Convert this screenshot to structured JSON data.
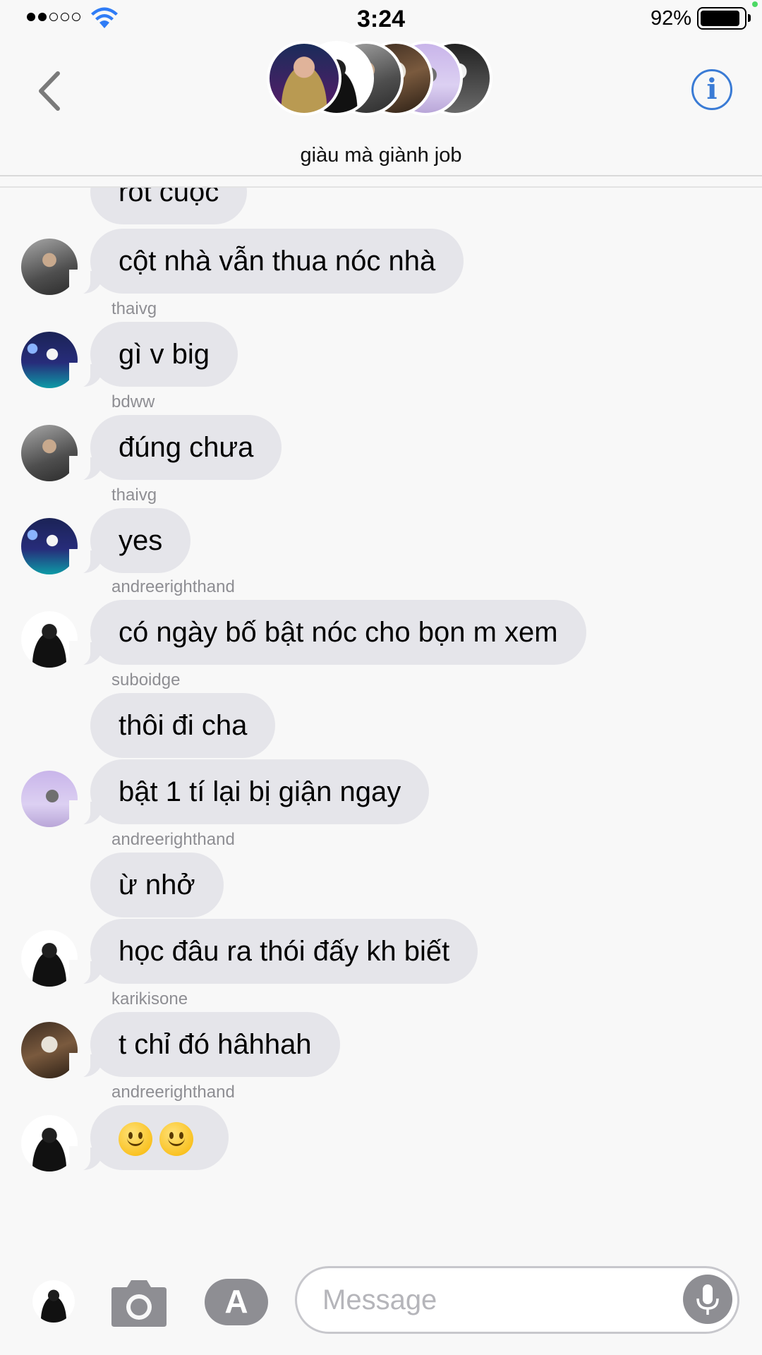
{
  "status_bar": {
    "time": "3:24",
    "battery_percent": "92%",
    "signal_bars": 2,
    "signal_total": 5,
    "battery_level": 0.92
  },
  "header": {
    "group_name": "giàu mà giành job",
    "icons": [
      "back-chevron-icon",
      "info-icon"
    ],
    "info_glyph": "i",
    "accent_color": "#3a7bd5"
  },
  "messages": [
    {
      "text": "rốt cuộc",
      "sender": "",
      "avatar": ""
    },
    {
      "text": "cột nhà vẫn thua nóc nhà",
      "sender": "",
      "avatar": "av-a"
    },
    {
      "text": "gì v big",
      "sender": "thaivg",
      "avatar": "av-b"
    },
    {
      "text": "đúng chưa",
      "sender": "bdww",
      "avatar": "av-a"
    },
    {
      "text": "yes",
      "sender": "thaivg",
      "avatar": "av-b"
    },
    {
      "text": "có ngày bố bật nóc cho bọn m xem",
      "sender": "andreerighthand",
      "avatar": "av-c"
    },
    {
      "text": "thôi đi cha",
      "sender": "suboidge",
      "avatar": ""
    },
    {
      "text": "bật 1 tí lại bị giận ngay",
      "sender": "",
      "avatar": "av-d"
    },
    {
      "text": "ừ nhở",
      "sender": "andreerighthand",
      "avatar": ""
    },
    {
      "text": "học đâu ra thói đấy kh biết",
      "sender": "",
      "avatar": "av-c"
    },
    {
      "text": "t chỉ đó hâhhah",
      "sender": "karikisone",
      "avatar": "av-e"
    },
    {
      "text": "",
      "sender": "andreerighthand",
      "avatar": "av-c",
      "emoji_count": 2
    }
  ],
  "composer": {
    "placeholder": "Message",
    "apps_glyph": "A",
    "icons": [
      "camera-icon",
      "app-store-icon",
      "microphone-icon"
    ]
  }
}
